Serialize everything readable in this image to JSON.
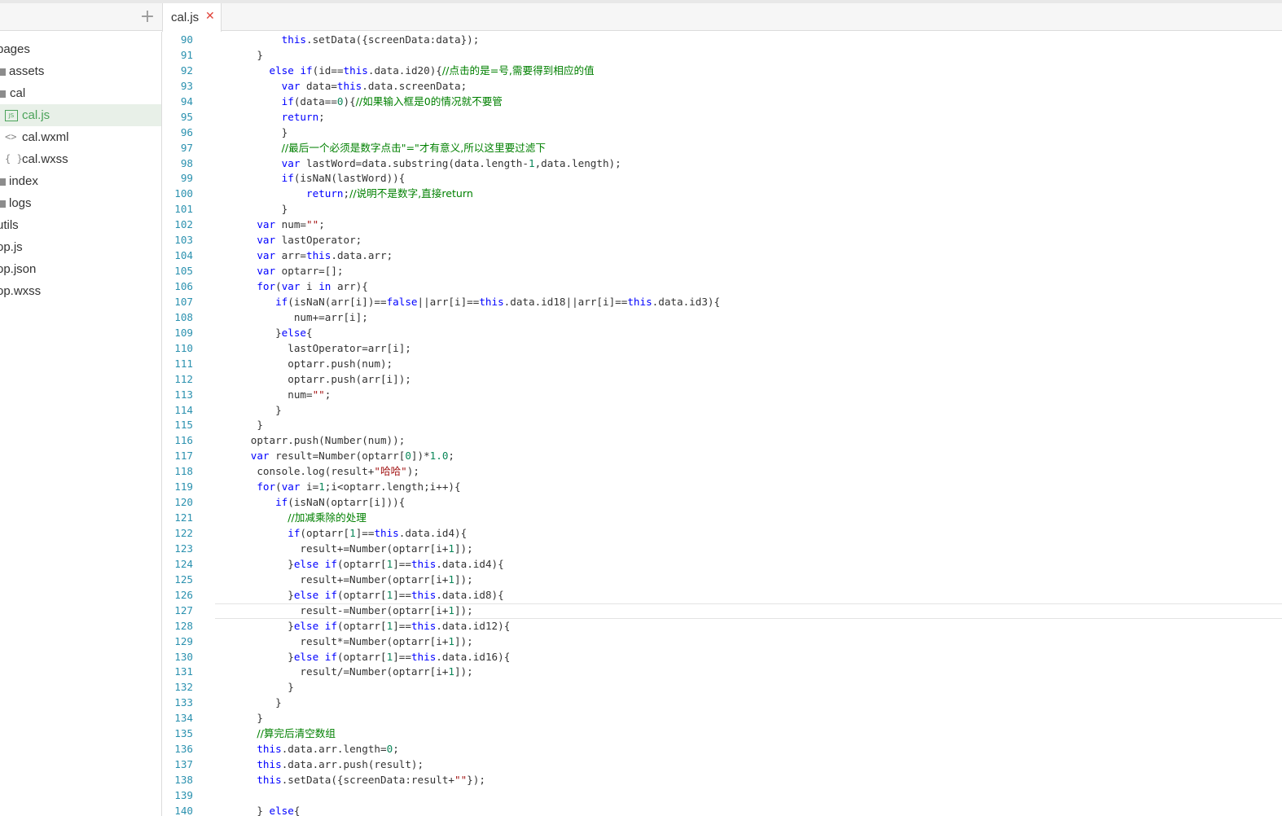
{
  "tab": {
    "label": "cal.js",
    "close": "✕",
    "add": "+"
  },
  "sidebar": {
    "items": [
      {
        "label": "pages"
      },
      {
        "label": "assets"
      },
      {
        "label": "cal"
      },
      {
        "label": "cal.js",
        "icon": "JS"
      },
      {
        "label": "cal.wxml",
        "icon": "<>"
      },
      {
        "label": "cal.wxss",
        "icon": "{ }"
      },
      {
        "label": "index"
      },
      {
        "label": "logs"
      },
      {
        "label": "utils"
      },
      {
        "label": "op.js"
      },
      {
        "label": "op.json"
      },
      {
        "label": "op.wxss"
      }
    ]
  },
  "editor": {
    "lines": [
      {
        "n": "90",
        "t": "        this.setData({screenData:data});"
      },
      {
        "n": "91",
        "t": "    }"
      },
      {
        "n": "92",
        "t": "      else if(id==this.data.id20){//点击的是=号,需要得到相应的值"
      },
      {
        "n": "93",
        "t": "        var data=this.data.screenData;"
      },
      {
        "n": "94",
        "t": "        if(data==0){//如果输入框是0的情况就不要管"
      },
      {
        "n": "95",
        "t": "        return;"
      },
      {
        "n": "96",
        "t": "        }"
      },
      {
        "n": "97",
        "t": "        //最后一个必须是数字点击\"=\"才有意义,所以这里要过滤下"
      },
      {
        "n": "98",
        "t": "        var lastWord=data.substring(data.length-1,data.length);"
      },
      {
        "n": "99",
        "t": "        if(isNaN(lastWord)){"
      },
      {
        "n": "100",
        "t": "            return;//说明不是数字,直接return"
      },
      {
        "n": "101",
        "t": "        }"
      },
      {
        "n": "102",
        "t": "    var num=\"\";"
      },
      {
        "n": "103",
        "t": "    var lastOperator;"
      },
      {
        "n": "104",
        "t": "    var arr=this.data.arr;"
      },
      {
        "n": "105",
        "t": "    var optarr=[];"
      },
      {
        "n": "106",
        "t": "    for(var i in arr){"
      },
      {
        "n": "107",
        "t": "       if(isNaN(arr[i])==false||arr[i]==this.data.id18||arr[i]==this.data.id3){"
      },
      {
        "n": "108",
        "t": "          num+=arr[i];"
      },
      {
        "n": "109",
        "t": "       }else{"
      },
      {
        "n": "110",
        "t": "         lastOperator=arr[i];"
      },
      {
        "n": "111",
        "t": "         optarr.push(num);"
      },
      {
        "n": "112",
        "t": "         optarr.push(arr[i]);"
      },
      {
        "n": "113",
        "t": "         num=\"\";"
      },
      {
        "n": "114",
        "t": "       }"
      },
      {
        "n": "115",
        "t": "    }"
      },
      {
        "n": "116",
        "t": "   optarr.push(Number(num));"
      },
      {
        "n": "117",
        "t": "   var result=Number(optarr[0])*1.0;"
      },
      {
        "n": "118",
        "t": "    console.log(result+\"哈哈\");"
      },
      {
        "n": "119",
        "t": "    for(var i=1;i<optarr.length;i++){"
      },
      {
        "n": "120",
        "t": "       if(isNaN(optarr[i])){"
      },
      {
        "n": "121",
        "t": "         //加减乘除的处理"
      },
      {
        "n": "122",
        "t": "         if(optarr[1]==this.data.id4){"
      },
      {
        "n": "123",
        "t": "           result+=Number(optarr[i+1]);"
      },
      {
        "n": "124",
        "t": "         }else if(optarr[1]==this.data.id4){"
      },
      {
        "n": "125",
        "t": "           result+=Number(optarr[i+1]);"
      },
      {
        "n": "126",
        "t": "         }else if(optarr[1]==this.data.id8){"
      },
      {
        "n": "127",
        "t": "           result-=Number(optarr[i+1]);"
      },
      {
        "n": "128",
        "t": "         }else if(optarr[1]==this.data.id12){"
      },
      {
        "n": "129",
        "t": "           result*=Number(optarr[i+1]);"
      },
      {
        "n": "130",
        "t": "         }else if(optarr[1]==this.data.id16){"
      },
      {
        "n": "131",
        "t": "           result/=Number(optarr[i+1]);"
      },
      {
        "n": "132",
        "t": "         }"
      },
      {
        "n": "133",
        "t": "       }"
      },
      {
        "n": "134",
        "t": "    }"
      },
      {
        "n": "135",
        "t": "    //算完后清空数组"
      },
      {
        "n": "136",
        "t": "    this.data.arr.length=0;"
      },
      {
        "n": "137",
        "t": "    this.data.arr.push(result);"
      },
      {
        "n": "138",
        "t": "    this.setData({screenData:result+\"\"});"
      },
      {
        "n": "139",
        "t": ""
      },
      {
        "n": "140",
        "t": "    } else{"
      }
    ],
    "current_line": "127"
  },
  "colors": {
    "keyword": "#0000ff",
    "comment": "#008000",
    "number": "#098658",
    "string": "#a31515",
    "line_number": "#2b91af"
  }
}
